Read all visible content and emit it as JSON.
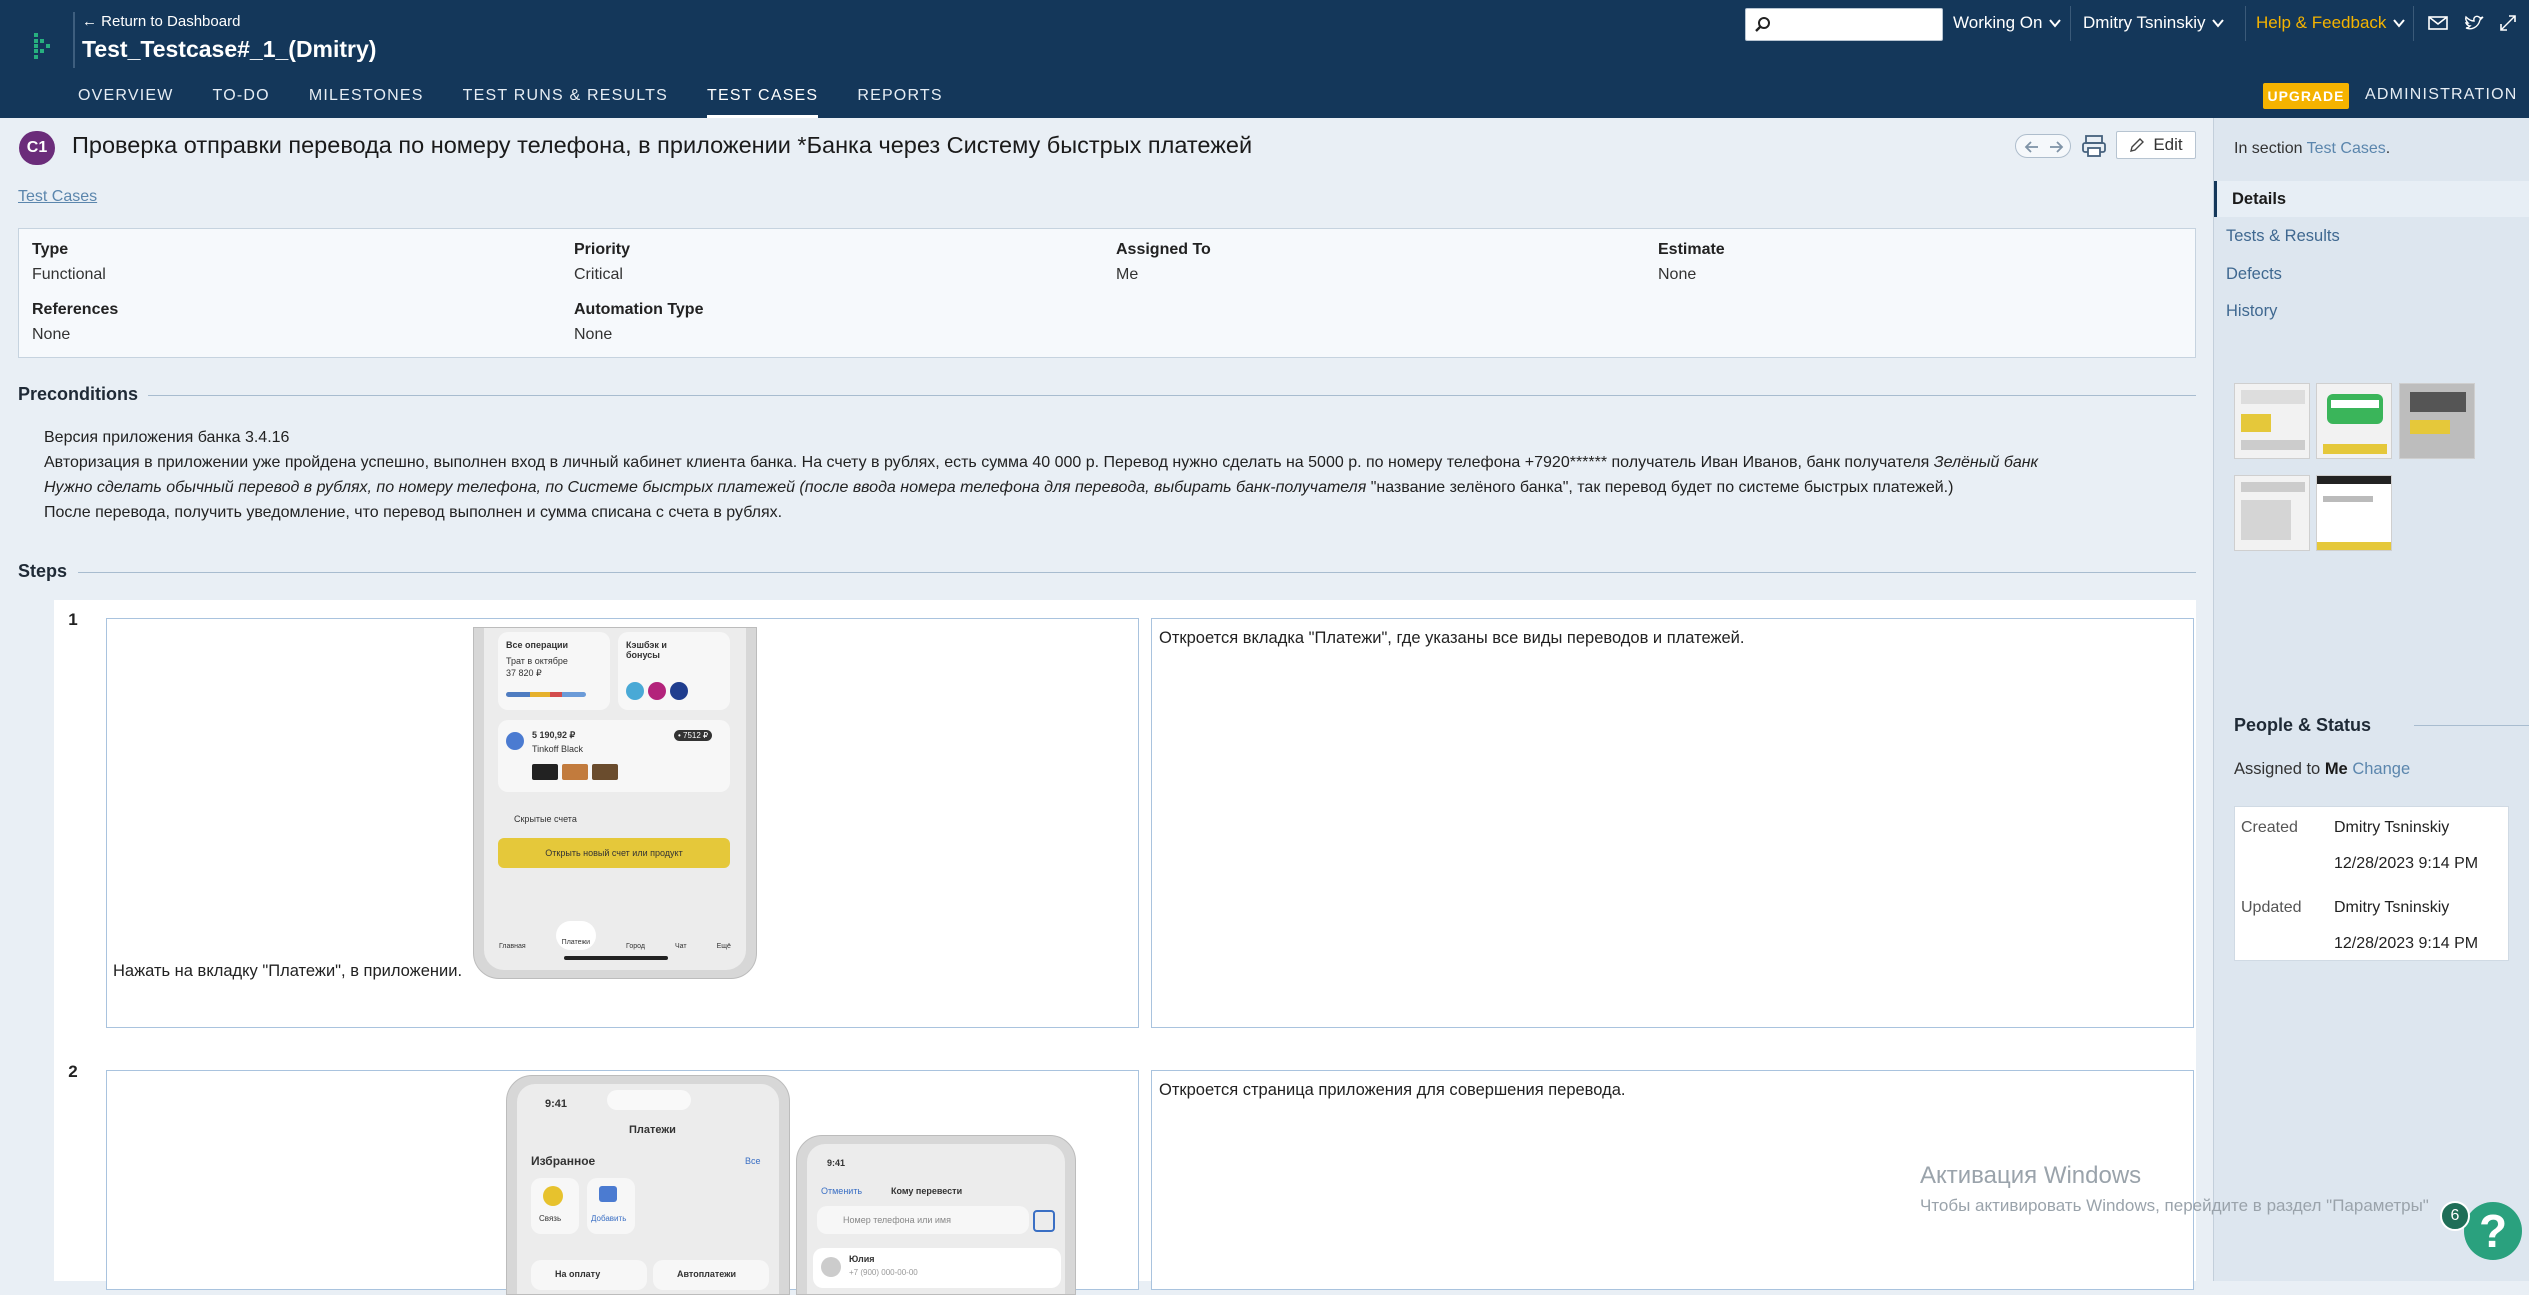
{
  "header": {
    "return_label": "← Return to Dashboard",
    "project_title": "Test_Testcase#_1_(Dmitry)",
    "search_placeholder": "",
    "working_on_label": "Working On",
    "user_menu_label": "Dmitry Tsninskiy",
    "help_label": "Help & Feedback",
    "help_color": "#f5b300",
    "upgrade_label": "UPGRADE",
    "administration_label": "ADMINISTRATION"
  },
  "nav": {
    "tabs": [
      {
        "label": "OVERVIEW",
        "active": false
      },
      {
        "label": "TO-DO",
        "active": false
      },
      {
        "label": "MILESTONES",
        "active": false
      },
      {
        "label": "TEST RUNS & RESULTS",
        "active": false
      },
      {
        "label": "TEST CASES",
        "active": true
      },
      {
        "label": "REPORTS",
        "active": false
      }
    ]
  },
  "case": {
    "id_badge": "C1",
    "title": "Проверка отправки перевода по номеру телефона, в приложении *Банка через Систему быстрых платежей",
    "edit_label": "Edit",
    "breadcrumb": "Test Cases",
    "badge_color": "#6b2c7a"
  },
  "details": {
    "type_label": "Type",
    "type_value": "Functional",
    "priority_label": "Priority",
    "priority_value": "Critical",
    "assigned_label": "Assigned To",
    "assigned_value": "Me",
    "estimate_label": "Estimate",
    "estimate_value": "None",
    "references_label": "References",
    "references_value": "None",
    "automation_label": "Automation Type",
    "automation_value": "None"
  },
  "preconditions": {
    "heading": "Preconditions",
    "line1": "Версия приложения банка 3.4.16",
    "line2_plain": "Авторизация в приложении уже пройдена успешно, выполнен вход в личный кабинет клиента банка. На счету в рублях, есть сумма 40 000 р. Перевод нужно сделать на 5000 р. по номеру телефона +7920****** получатель Иван Иванов, банк получателя ",
    "line2_italic": "Зелёный банк",
    "line3_italic": "Нужно сделать обычный перевод в рублях, по номеру телефона, по Системе быстрых платежей (после ввода номера телефона для перевода, выбирать банк-получателя ",
    "line3_plain": "\"название зелёного банка\", так перевод будет по системе быстрых платежей.)",
    "line4": "После перевода, получить уведомление, что перевод выполнен и сумма списана с счета в рублях."
  },
  "steps": {
    "heading": "Steps",
    "items": [
      {
        "number": "1",
        "content": "Нажать на вкладку \"Платежи\", в приложении.",
        "expected": "Откроется вкладка \"Платежи\", где указаны все виды переводов и платежей.",
        "screen": {
          "tile1_title": "Все операции",
          "tile1_sub": "Трат в октябре",
          "tile1_amount": "37 820 ₽",
          "tile2_title": "Кэшбэк и бонусы",
          "balance": "5 190,92 ₽",
          "card_name": "Tinkoff Black",
          "card_badge": "• 7512 ₽",
          "hidden_accounts": "Скрытые счета",
          "open_button": "Открыть новый счет или продукт",
          "tabbar": [
            "Главная",
            "Платежи",
            "Город",
            "Чат",
            "Ещё"
          ]
        }
      },
      {
        "number": "2",
        "content": "",
        "expected": "Откроется страница приложения для совершения перевода.",
        "screen": {
          "time": "9:41",
          "payments_title": "Платежи",
          "favorites_label": "Избранное",
          "all_label": "Все",
          "fav1": "Связь",
          "fav2": "Добавить",
          "to_pay": "На оплату",
          "autopay": "Автоплатежи",
          "time2": "9:41",
          "cancel": "Отменить",
          "whom": "Кому перевести",
          "phone_placeholder": "Номер телефона или имя",
          "contact_name": "Юлия",
          "contact_phone": "+7 (900) 000-00-00"
        }
      }
    ]
  },
  "sidebar": {
    "in_section_prefix": "In section ",
    "in_section_link": "Test Cases",
    "in_section_suffix": ".",
    "tabs": [
      {
        "label": "Details",
        "active": true
      },
      {
        "label": "Tests & Results",
        "active": false
      },
      {
        "label": "Defects",
        "active": false
      },
      {
        "label": "History",
        "active": false
      }
    ],
    "people_heading": "People & Status",
    "assigned_prefix": "Assigned to ",
    "assigned_value": "Me",
    "change_label": "Change",
    "created_label": "Created",
    "created_by": "Dmitry Tsninskiy",
    "created_at": "12/28/2023 9:14 PM",
    "updated_label": "Updated",
    "updated_by": "Dmitry Tsninskiy",
    "updated_at": "12/28/2023 9:14 PM"
  },
  "watermark": {
    "title": "Активация Windows",
    "subtitle": "Чтобы активировать Windows, перейдите в раздел \"Параметры\""
  },
  "help_widget": {
    "count": "6",
    "symbol": "?"
  }
}
